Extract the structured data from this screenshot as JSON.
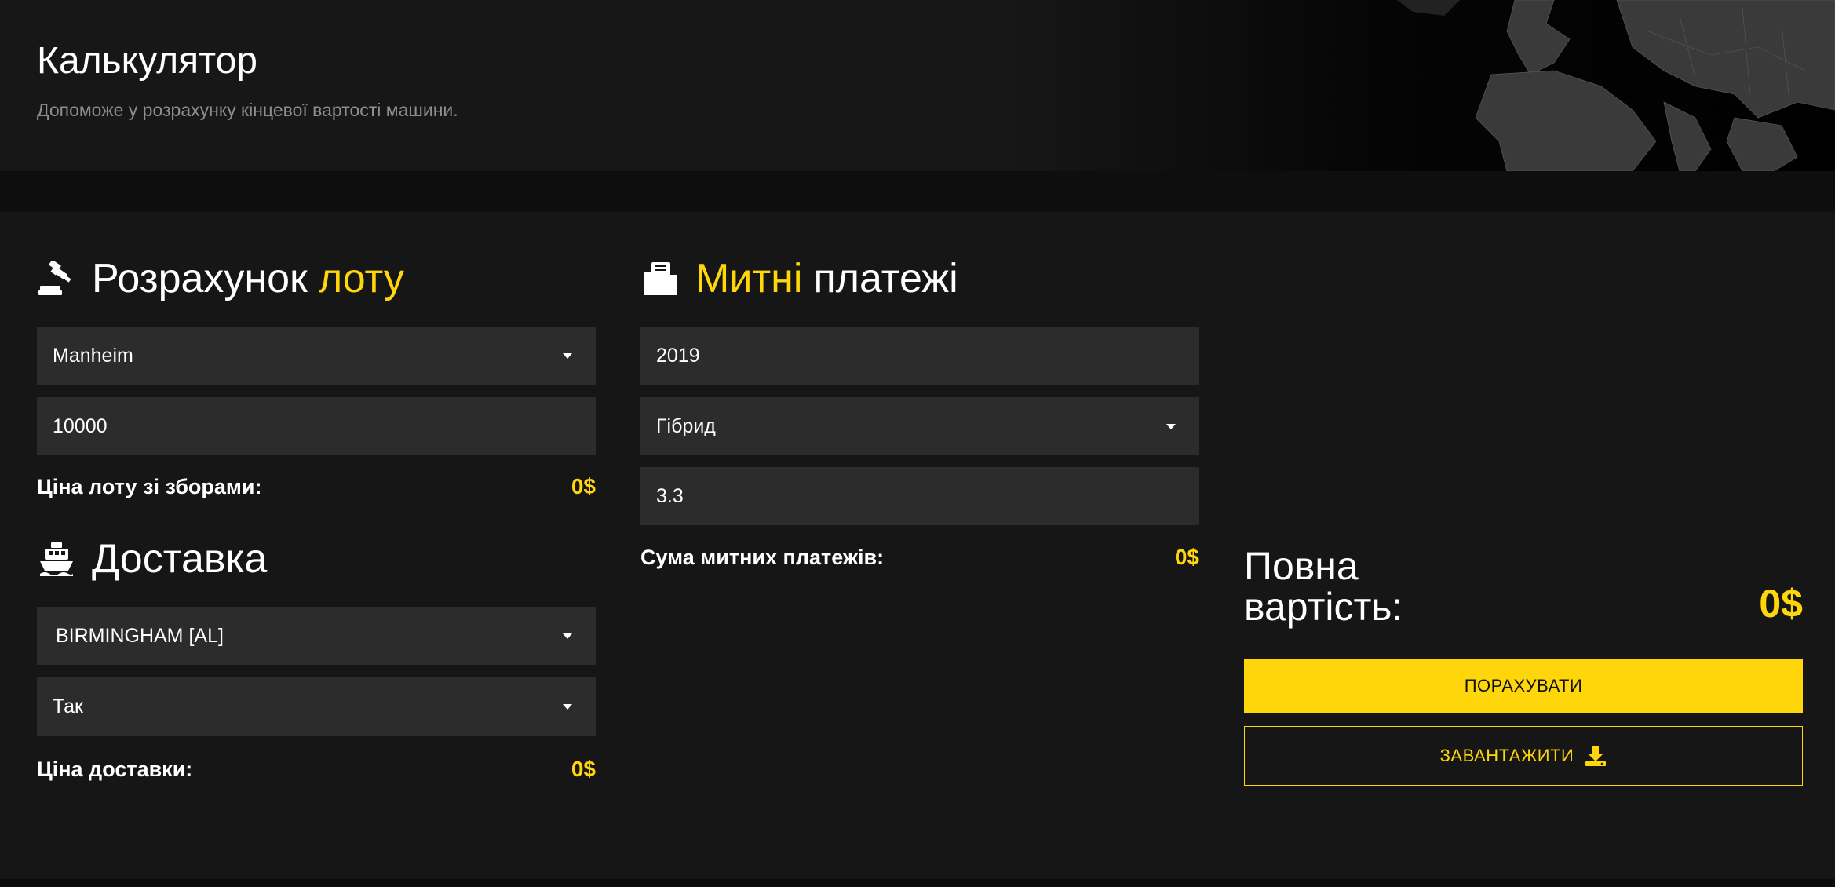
{
  "header": {
    "title": "Калькулятор",
    "subtitle": "Допоможе у розрахунку кінцевої вартості машини."
  },
  "lot": {
    "heading_part1": "Розрахунок",
    "heading_part2": "лоту",
    "icon": "gavel-icon",
    "auction_select": "Manheim",
    "price_input": "10000",
    "summary_label": "Ціна лоту зі зборами:",
    "summary_value": "0$"
  },
  "delivery": {
    "heading": "Доставка",
    "icon": "ship-icon",
    "port_select": "BIRMINGHAM [AL]",
    "option_select": "Так",
    "summary_label": "Ціна доставки:",
    "summary_value": "0$"
  },
  "customs": {
    "heading_part1": "Митні",
    "heading_part2": "платежі",
    "icon": "folder-icon",
    "year_input": "2019",
    "fuel_select": "Гібрид",
    "engine_input": "3.3",
    "summary_label": "Сума митних платежів:",
    "summary_value": "0$"
  },
  "total": {
    "label_line1": "Повна",
    "label_line2": "вартість:",
    "value": "0$",
    "calculate_button": "ПОРАХУВАТИ",
    "download_button": "ЗАВАНТАЖИТИ",
    "download_icon": "download-icon"
  },
  "colors": {
    "accent": "#ffd60a",
    "background": "#161616",
    "field": "#2c2c2c"
  }
}
